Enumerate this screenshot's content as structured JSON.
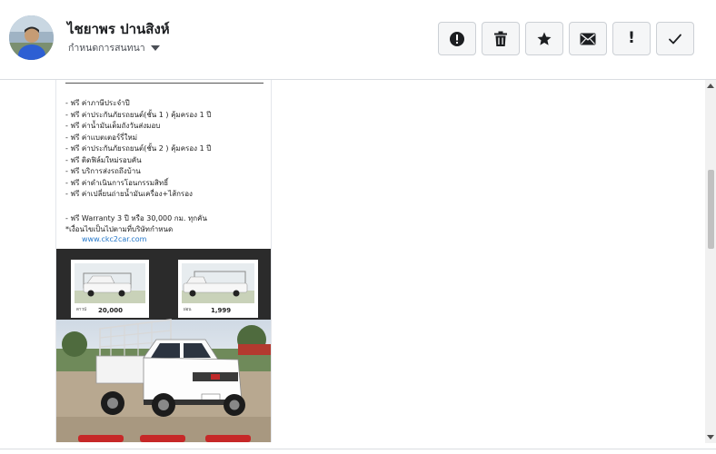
{
  "header": {
    "contact_name": "ไชยาพร ปานสิงห์",
    "conversation_settings_label": "กำหนดการสนทนา"
  },
  "toolbar": {
    "actions": [
      {
        "name": "report",
        "icon": "alert-circle-icon"
      },
      {
        "name": "delete",
        "icon": "trash-icon"
      },
      {
        "name": "star",
        "icon": "star-icon"
      },
      {
        "name": "mark-unread",
        "icon": "envelope-icon"
      },
      {
        "name": "mark-spam",
        "icon": "exclamation-icon",
        "glyph": "!"
      },
      {
        "name": "mark-done",
        "icon": "checkmark-icon"
      }
    ]
  },
  "attachment": {
    "list_text": "- ฟรี ค่าภาษีประจำปี\n- ฟรี ค่าประกันภัยรถยนต์(ชั้น 1 ) คุ้มครอง 1 ปี\n- ฟรี ค่าน้ำมันเต็มถังวันส่งมอบ\n- ฟรี ค่าแบตเตอร์รี่ใหม่\n- ฟรี ค่าประกันภัยรถยนต์(ชั้น 2 ) คุ้มครอง 1 ปี\n- ฟรี ติดฟิล์มใหม่รอบคัน\n- ฟรี บริการส่งรถถึงบ้าน\n- ฟรี ค่าดำเนินการโอนกรรมสิทธิ์\n- ฟรี ค่าเปลี่ยนถ่ายน้ำมันเครื่อง+ไส้กรอง",
    "warranty_text": "- ฟรี Warranty 3 ปี หรือ 30,000 กม. ทุกคัน\n*เงื่อนไขเป็นไปตามที่บริษัทกำหนด",
    "website": "www.ckc2car.com",
    "price_left": "20,000",
    "price_right": "1,999"
  },
  "colors": {
    "accent": "#2477c9",
    "button_bg": "#f5f6f7",
    "button_border": "#ccd0d5"
  }
}
